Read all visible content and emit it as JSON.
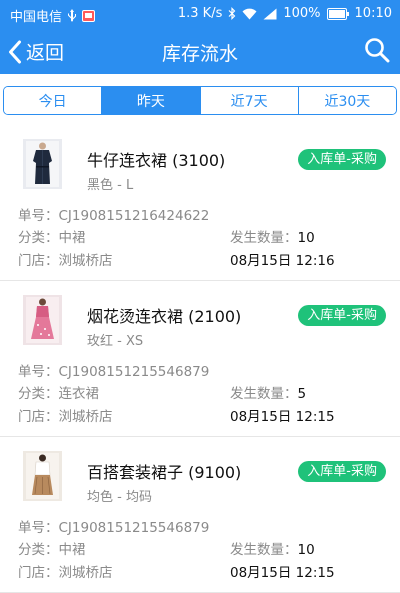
{
  "statusbar": {
    "carrier": "中国电信",
    "speed": "1.3 K/s",
    "battery": "100%",
    "time": "10:10",
    "icons": [
      "usb-icon",
      "sim-icon",
      "bluetooth-icon",
      "wifi-icon",
      "signal-icon",
      "battery-icon"
    ]
  },
  "header": {
    "back_label": "返回",
    "title": "库存流水"
  },
  "tabs": [
    {
      "label": "今日",
      "active": false
    },
    {
      "label": "昨天",
      "active": true
    },
    {
      "label": "近7天",
      "active": false
    },
    {
      "label": "近30天",
      "active": false
    }
  ],
  "records": [
    {
      "name": "牛仔连衣裙 (3100)",
      "variant": "黑色 - L",
      "badge": "入库单-采购",
      "order": "单号：CJ1908151216424622",
      "category_label": "分类：",
      "category": "中裙",
      "qty_label": "发生数量：",
      "qty": "10",
      "store_label": "门店：",
      "store": "浏城桥店",
      "time": "08月15日 12:16"
    },
    {
      "name": "烟花烫连衣裙 (2100)",
      "variant": "玫红 - XS",
      "badge": "入库单-采购",
      "order": "单号：CJ1908151215546879",
      "category_label": "分类：",
      "category": "连衣裙",
      "qty_label": "发生数量：",
      "qty": "5",
      "store_label": "门店：",
      "store": "浏城桥店",
      "time": "08月15日 12:15"
    },
    {
      "name": "百搭套装裙子 (9100)",
      "variant": "均色 - 均码",
      "badge": "入库单-采购",
      "order": "单号：CJ1908151215546879",
      "category_label": "分类：",
      "category": "中裙",
      "qty_label": "发生数量：",
      "qty": "10",
      "store_label": "门店：",
      "store": "浏城桥店",
      "time": "08月15日 12:15"
    }
  ],
  "colors": {
    "primary": "#2b8ef0",
    "badge": "#1fc27a"
  }
}
